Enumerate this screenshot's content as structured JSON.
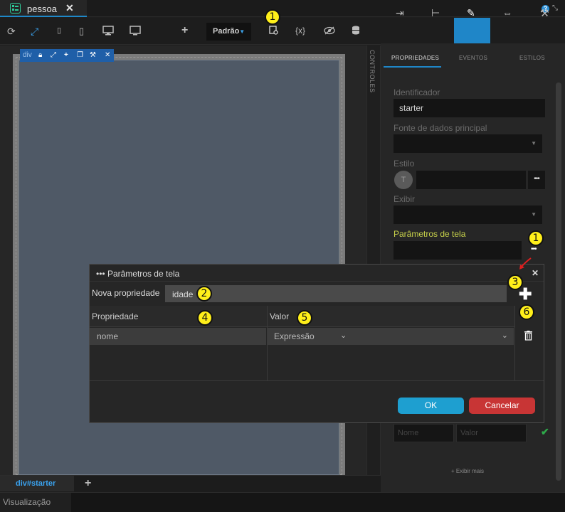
{
  "tab": {
    "title": "pessoa",
    "close": "✕"
  },
  "window": {
    "help": "?"
  },
  "toolbar": {
    "device_select": "Padrão",
    "variables": "{x}"
  },
  "canvas": {
    "element_label": "div",
    "side_panel": "CONTROLES"
  },
  "breadcrumb": {
    "item": "div#starter",
    "add": "+"
  },
  "bottom": {
    "tab": "Visualização"
  },
  "right_panel": {
    "tabs": [
      "PROPRIEDADES",
      "EVENTOS",
      "ESTILOS"
    ],
    "fields": {
      "identificador_label": "Identificador",
      "identificador_value": "starter",
      "fonte_label": "Fonte de dados principal",
      "estilo_label": "Estilo",
      "estilo_initial": "T",
      "exibir_label": "Exibir",
      "params_label": "Parâmetros de tela"
    },
    "nome_placeholder": "Nome",
    "valor_placeholder": "Valor",
    "exibir_mais": "+ Exibir mais"
  },
  "dialog": {
    "title": "Parâmetros de tela",
    "new_property_label": "Nova propriedade",
    "new_property_value": "idade",
    "col_property": "Propriedade",
    "col_value": "Valor",
    "rows": [
      {
        "property": "nome",
        "value": "Expressão"
      }
    ],
    "ok": "OK",
    "cancel": "Cancelar"
  },
  "annotations": {
    "badge1": "1",
    "badge2": "2",
    "badge3": "3",
    "badge4": "4",
    "badge5": "5",
    "badge6": "6"
  },
  "colors": {
    "accent": "#1f86c8",
    "ok": "#1e9fd0",
    "cancel": "#c83535",
    "badge": "#ffef1a",
    "params_label": "#c8d24a"
  }
}
